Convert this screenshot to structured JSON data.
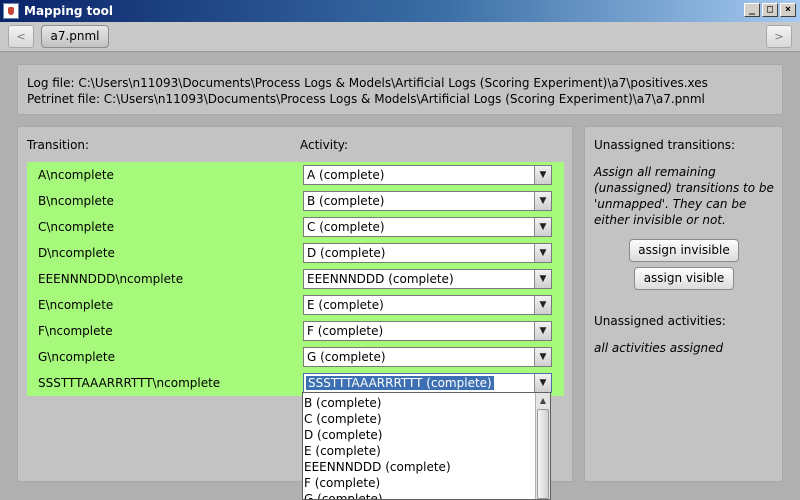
{
  "window": {
    "title": "Mapping tool"
  },
  "tabstrip": {
    "prev_label": "<",
    "next_label": ">",
    "tabs": [
      {
        "label": "a7.pnml"
      }
    ]
  },
  "info": {
    "log_file": "Log file: C:\\Users\\n11093\\Documents\\Process Logs & Models\\Artificial Logs (Scoring Experiment)\\a7\\positives.xes",
    "petrinet_file": "Petrinet file: C:\\Users\\n11093\\Documents\\Process Logs & Models\\Artificial Logs (Scoring Experiment)\\a7\\a7.pnml"
  },
  "mapping": {
    "transition_header": "Transition:",
    "activity_header": "Activity:",
    "rows": [
      {
        "transition": "A\\ncomplete",
        "activity": "A (complete)"
      },
      {
        "transition": "B\\ncomplete",
        "activity": "B (complete)"
      },
      {
        "transition": "C\\ncomplete",
        "activity": "C (complete)"
      },
      {
        "transition": "D\\ncomplete",
        "activity": "D (complete)"
      },
      {
        "transition": "EEENNNDDD\\ncomplete",
        "activity": "EEENNNDDD (complete)"
      },
      {
        "transition": "E\\ncomplete",
        "activity": "E (complete)"
      },
      {
        "transition": "F\\ncomplete",
        "activity": "F (complete)"
      },
      {
        "transition": "G\\ncomplete",
        "activity": "G (complete)"
      },
      {
        "transition": "SSSTTTAAARRRTTT\\ncomplete",
        "activity": "SSSTTTAAARRRTTT (complete)"
      }
    ],
    "dropdown_options": [
      "B (complete)",
      "C (complete)",
      "D (complete)",
      "E (complete)",
      "EEENNNDDD (complete)",
      "F (complete)",
      "G (complete)"
    ]
  },
  "side": {
    "unassigned_transitions_header": "Unassigned transitions:",
    "description": "Assign all remaining (unassigned) transitions to be 'unmapped'. They can be either invisible or not.",
    "assign_invisible_label": "assign invisible",
    "assign_visible_label": "assign visible",
    "unassigned_activities_header": "Unassigned activities:",
    "activities_status": "all activities assigned"
  },
  "colors": {
    "row_background": "#a6f97a",
    "selection": "#3c6fb3"
  },
  "icons": {
    "combo_arrow": "chevron-down-icon",
    "scroll_up": "arrow-up-icon"
  }
}
